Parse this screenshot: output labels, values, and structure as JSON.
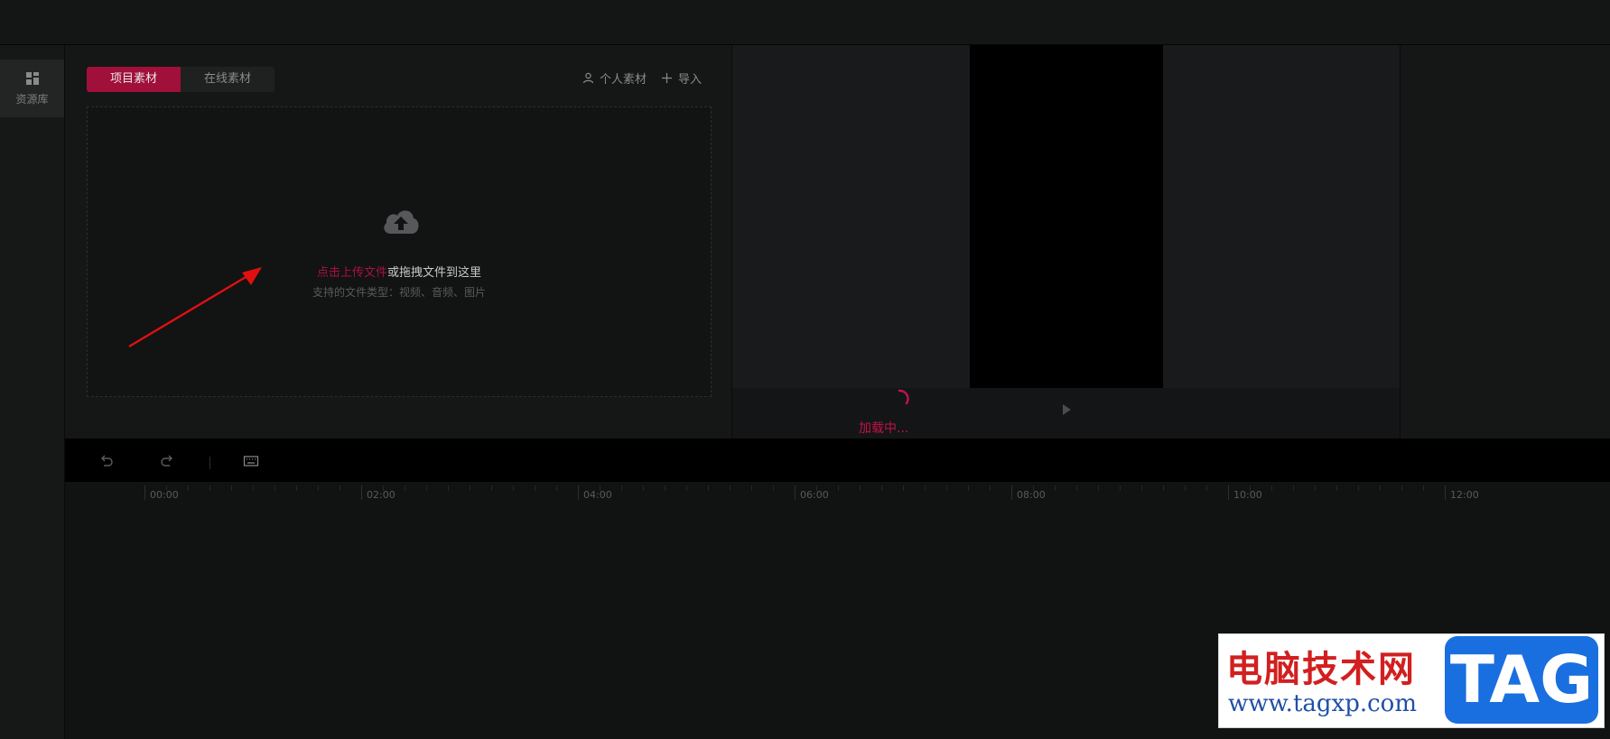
{
  "sidebar": {
    "items": [
      {
        "label": "资源库",
        "icon": "grid-icon"
      }
    ]
  },
  "asset_panel": {
    "tabs": [
      {
        "label": "项目素材",
        "active": true
      },
      {
        "label": "在线素材",
        "active": false
      }
    ],
    "actions": [
      {
        "label": "个人素材",
        "icon": "user-icon"
      },
      {
        "label": "导入",
        "icon": "plus-icon"
      }
    ],
    "dropzone": {
      "link_text": "点击上传文件",
      "text": "或拖拽文件到这里",
      "subtext": "支持的文件类型：视频、音频、图片"
    }
  },
  "preview": {
    "loading_text": "加载中..."
  },
  "timeline": {
    "ticks": [
      "00:00",
      "02:00",
      "04:00",
      "06:00",
      "08:00",
      "10:00",
      "12:00"
    ]
  },
  "watermark": {
    "title": "电脑技术网",
    "url": "www.tagxp.com",
    "tag": "TAG"
  },
  "colors": {
    "accent": "#a0103a",
    "loading": "#c0134a"
  }
}
